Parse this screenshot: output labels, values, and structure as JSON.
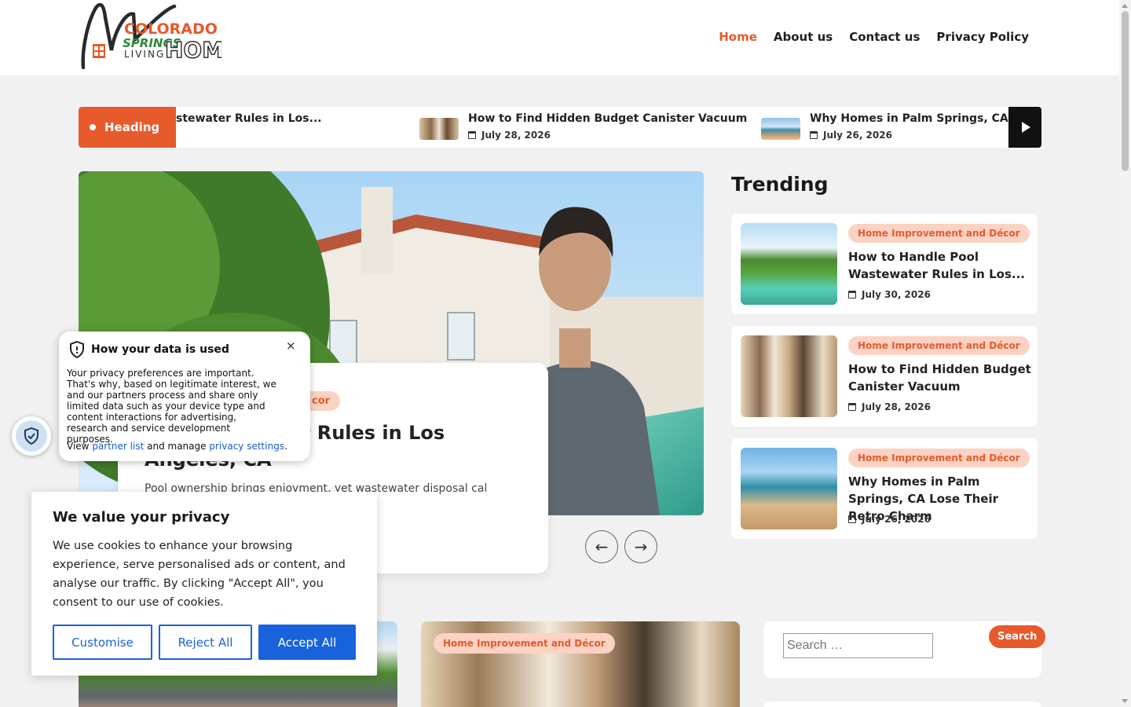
{
  "brand": {
    "line1": "COLORADO",
    "line2": "SPRINGS",
    "line3": "LIVING",
    "line4": "HOME"
  },
  "nav": {
    "items": [
      {
        "label": "Home"
      },
      {
        "label": "About us"
      },
      {
        "label": "Contact us"
      },
      {
        "label": "Privacy Policy"
      }
    ]
  },
  "ticker": {
    "badge": "Heading",
    "items": [
      {
        "title": "stewater Rules in Los...",
        "date": ""
      },
      {
        "title": "How to Find Hidden Budget Canister Vacuum",
        "date": "July 28, 2026"
      },
      {
        "title": "Why Homes in Palm Springs, CA Lose Their...",
        "date": "July 26, 2026"
      }
    ]
  },
  "hero": {
    "category": "cor",
    "title": "ool Wastewater Rules in Los Angeles, CA",
    "excerpt": "Pool ownership brings enjoyment, yet wastewater disposal cal water quality...."
  },
  "trending": {
    "title": "Trending",
    "items": [
      {
        "category": "Home Improvement and Décor",
        "title": "How to Handle Pool Wastewater Rules in Los...",
        "date": "July 30, 2026"
      },
      {
        "category": "Home Improvement and Décor",
        "title": "How to Find Hidden Budget Canister Vacuum",
        "date": "July 28, 2026"
      },
      {
        "category": "Home Improvement and Décor",
        "title": "Why Homes in Palm Springs, CA Lose Their Retro Charm",
        "date": "July 26, 2026"
      }
    ]
  },
  "posts": [
    {
      "category": "Home Improvement and Décor"
    }
  ],
  "search": {
    "placeholder": "Search …",
    "button": "Search"
  },
  "data_popup": {
    "title": "How your data is used",
    "close": "×",
    "body": "Your privacy preferences are important. That's why, based on legitimate interest, we and our partners process and share only limited data such as your device type and content interactions for advertising, research and service development purposes.",
    "links_prefix": "View",
    "partner_link": "partner list",
    "links_middle": "and manage",
    "settings_link": "privacy settings",
    "links_suffix": "."
  },
  "cookie": {
    "title": "We value your privacy",
    "text": "We use cookies to enhance your browsing experience, serve personalised ads or content, and analyse our traffic. By clicking \"Accept All\", you consent to our use of cookies.",
    "customise": "Customise",
    "reject": "Reject All",
    "accept": "Accept All"
  },
  "colors": {
    "accent": "#e65a2c",
    "accent_soft": "#fcd2c3",
    "cookie_blue": "#1863dc",
    "link_blue": "#1a5dcc"
  }
}
